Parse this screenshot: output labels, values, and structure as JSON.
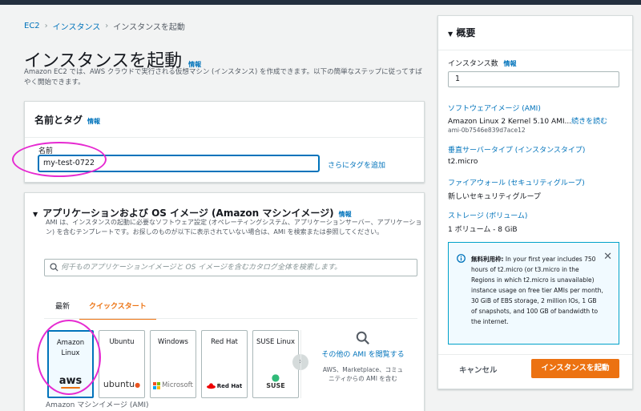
{
  "breadcrumb": [
    {
      "label": "EC2"
    },
    {
      "label": "インスタンス"
    },
    {
      "label": "インスタンスを起動"
    }
  ],
  "page": {
    "title": "インスタンスを起動",
    "info": "情報",
    "description": "Amazon EC2 では、AWS クラウドで実行される仮想マシン (インスタンス) を作成できます。以下の簡単なステップに従ってすばやく開始できます。"
  },
  "name_tags": {
    "header": "名前とタグ",
    "info": "情報",
    "field_label": "名前",
    "value": "my-test-0722",
    "add_tags": "さらにタグを追加"
  },
  "ami": {
    "header": "アプリケーションおよび OS イメージ (Amazon マシンイメージ)",
    "info": "情報",
    "description": "AMI は、インスタンスの起動に必要なソフトウェア設定 (オペレーティングシステム、アプリケーションサーバー、アプリケーション) を含むテンプレートです。お探しのものが以下に表示されていない場合は、AMI を検索または参照してください。",
    "search_placeholder": "何千ものアプリケーションイメージと OS イメージを含むカタログ全体を検索します。",
    "tabs": [
      "最新",
      "クイックスタート"
    ],
    "active_tab": "クイックスタート",
    "os_cards": [
      {
        "name": "Amazon Linux",
        "logo": "aws"
      },
      {
        "name": "Ubuntu",
        "logo": "ubuntu"
      },
      {
        "name": "Windows",
        "logo": "Microsoft"
      },
      {
        "name": "Red Hat",
        "logo": "Red Hat"
      },
      {
        "name": "SUSE Linux",
        "logo": "SUSE"
      }
    ],
    "more_label": "その他の AMI を閲覧する",
    "more_sub": "AWS、Marketplace、コミュニティからの AMI を含む",
    "footer_label": "Amazon マシンイメージ (AMI)"
  },
  "summary": {
    "header": "概要",
    "instance_count_label": "インスタンス数",
    "info": "情報",
    "instance_count": "1",
    "software_image_label": "ソフトウェアイメージ (AMI)",
    "software_image_value": "Amazon Linux 2 Kernel 5.10 AMI...",
    "read_more": "続きを読む",
    "ami_id": "ami-0b7546e839d7ace12",
    "server_type_label": "垂直サーバータイプ (インスタンスタイプ)",
    "server_type_value": "t2.micro",
    "firewall_label": "ファイアウォール (セキュリティグループ)",
    "firewall_value": "新しいセキュリティグループ",
    "storage_label": "ストレージ (ボリューム)",
    "storage_value": "1 ボリューム - 8 GiB",
    "notice_bold": "無料利用枠:",
    "notice_text": " In your first year includes 750 hours of t2.micro (or t3.micro in the Regions in which t2.micro is unavailable) instance usage on free tier AMIs per month, 30 GiB of EBS storage, 2 million IOs, 1 GB of snapshots, and 100 GB of bandwidth to the internet.",
    "cancel": "キャンセル",
    "launch": "インスタンスを起動"
  },
  "colors": {
    "accent": "#ec7211",
    "link": "#0073bb",
    "annotation": "#e62ad1"
  }
}
